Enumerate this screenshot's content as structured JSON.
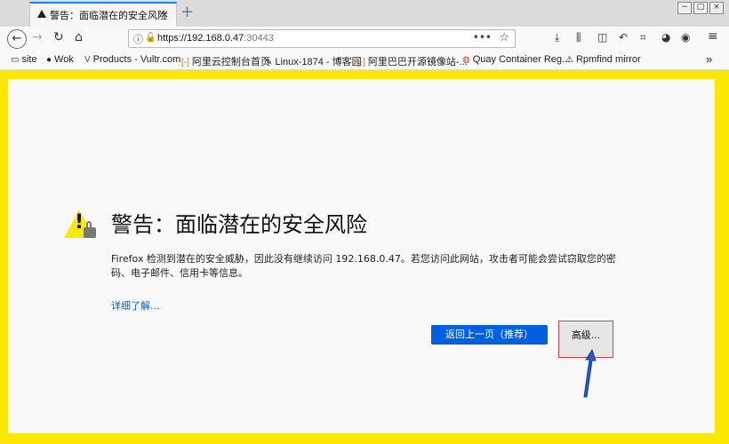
{
  "tab": {
    "title": "警告：面临潜在的安全风险",
    "close": "×",
    "new_tab": "+"
  },
  "window_controls": [
    "−",
    "□",
    "×"
  ],
  "nav": {
    "url_host": "https://192.168.0.47",
    "url_port": ":30443"
  },
  "bookmarks": [
    {
      "icon": "site-icon",
      "label": "site"
    },
    {
      "icon": "wok-icon",
      "label": "Wok"
    },
    {
      "icon": "vultr-icon",
      "label": "Products - Vultr.com"
    },
    {
      "icon": "aliyun-icon",
      "label": "阿里云控制台首页"
    },
    {
      "icon": "cnblogs-icon",
      "label": "Linux-1874 - 博客园"
    },
    {
      "icon": "aliyun-icon",
      "label": "阿里巴巴开源镜像站-..."
    },
    {
      "icon": "quay-icon",
      "label": "Quay Container Reg..."
    },
    {
      "icon": "rpmfind-icon",
      "label": "Rpmfind mirror"
    }
  ],
  "page": {
    "headline": "警告：面临潜在的安全风险",
    "description": "Firefox 检测到潜在的安全威胁，因此没有继续访问 192.168.0.47。若您访问此网站，攻击者可能会尝试窃取您的密码、电子邮件、信用卡等信息。",
    "learn_more": "详细了解...",
    "back_button": "返回上一页（推荐）",
    "advanced_button": "高级..."
  },
  "colors": {
    "frame": "#fde600",
    "primary_button": "#0060df",
    "highlight": "#e04040",
    "arrow": "#2a55c8"
  }
}
